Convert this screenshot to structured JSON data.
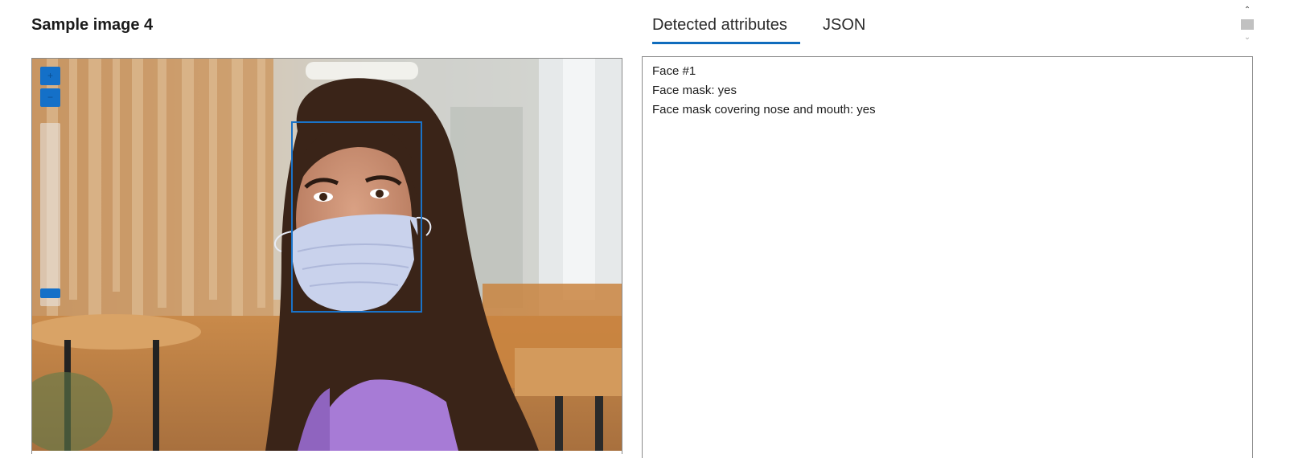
{
  "panel": {
    "title": "Sample image 4"
  },
  "image": {
    "alt": "Woman with long dark hair wearing a light blue face mask and a purple shirt, smiling, in a blurred office lobby",
    "box_color": "#1a73c8",
    "zoom_in_icon": "plus-icon",
    "zoom_out_icon": "minus-icon"
  },
  "tabs": [
    {
      "label": "Detected attributes",
      "active": true
    },
    {
      "label": "JSON",
      "active": false
    }
  ],
  "colors": {
    "accent": "#0f6cbd",
    "zoom_control": "#1470c8"
  },
  "results": {
    "lines": [
      "Face #1",
      "Face mask: yes",
      "Face mask covering nose and mouth: yes"
    ]
  }
}
